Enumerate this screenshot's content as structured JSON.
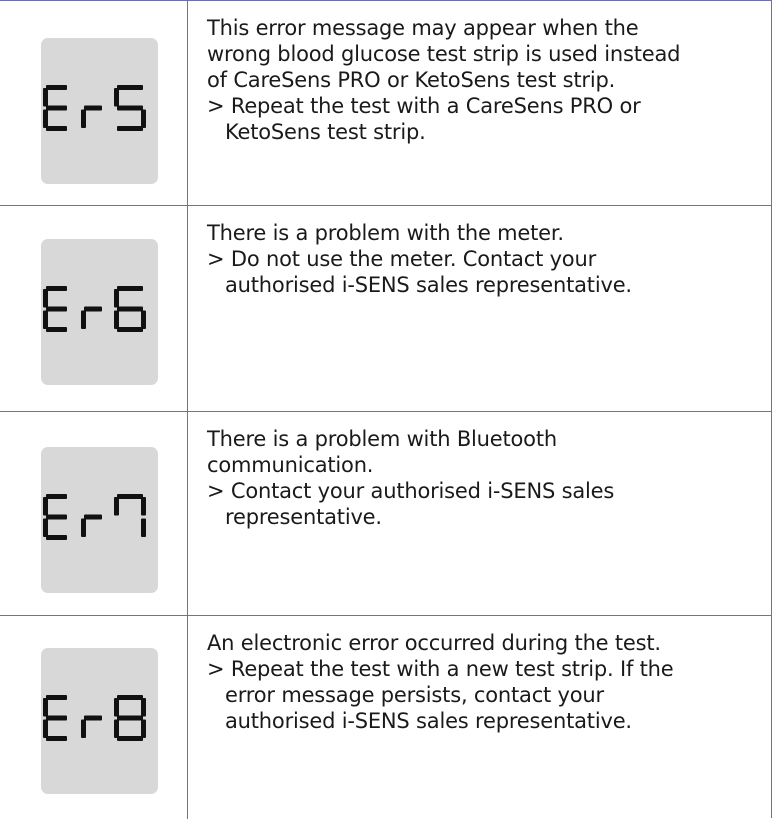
{
  "errors": [
    {
      "code": "Er5",
      "digits": [
        "E",
        "r",
        "5"
      ],
      "description_lines": [
        "This error message may appear when the",
        "wrong blood glucose test strip is used instead",
        "of CareSens PRO or KetoSens test strip."
      ],
      "action_lines": [
        "> Repeat the test with a CareSens PRO or",
        "KetoSens test strip."
      ]
    },
    {
      "code": "Er6",
      "digits": [
        "E",
        "r",
        "6"
      ],
      "description_lines": [
        "There is a problem with the meter."
      ],
      "action_lines": [
        "> Do not use the meter. Contact your",
        "authorised i-SENS sales representative."
      ]
    },
    {
      "code": "Er7",
      "digits": [
        "E",
        "r",
        "7"
      ],
      "description_lines": [
        "There is a problem with Bluetooth",
        "communication."
      ],
      "action_lines": [
        "> Contact your authorised i-SENS sales",
        "representative."
      ]
    },
    {
      "code": "Er8",
      "digits": [
        "E",
        "r",
        "8"
      ],
      "description_lines": [
        "An electronic error occurred during the test."
      ],
      "action_lines": [
        "> Repeat the test with a new test strip. If the",
        "error message persists, contact your",
        "authorised i-SENS sales representative."
      ]
    }
  ],
  "colors": {
    "border": "#6e6ea8",
    "lcd_background": "#d8d8d8",
    "segment": "#111111",
    "text": "#1a1a1a"
  }
}
